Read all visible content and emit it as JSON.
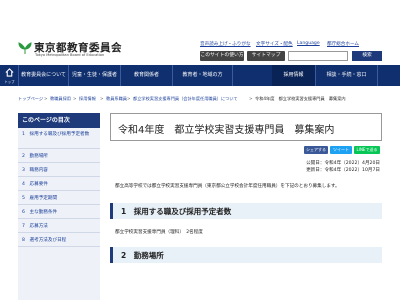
{
  "header": {
    "logo_name": "東京都教育委員会",
    "logo_sub": "Tokyo Metropolitan Board of Education",
    "util_links": [
      "音声読み上げ・ふりがな",
      "文字サイズ・配色",
      "Language",
      "都庁総合ホーム"
    ],
    "site_usage": "このサイトの使い方",
    "sitemap": "サイトマップ",
    "search_placeholder": "",
    "search_label": "検索"
  },
  "nav": {
    "home": "トップ",
    "items": [
      "教育委員会について",
      "児童・生徒・保護者",
      "教育関係者",
      "教育者・地域の方",
      "採用情報",
      "相談・手続・窓口"
    ]
  },
  "breadcrumb": [
    "トップページ",
    "教職員採用",
    "採用情報",
    "教員系職員",
    "都立学校実習支援専門員（会計年度任用職員）について",
    "令和4年度　都立学校実習支援専門員　募集案内"
  ],
  "toc": {
    "title": "このページの目次",
    "items": [
      "1　採用する職及び採用予定者数",
      "2　勤務場所",
      "3　職務内容",
      "4　応募要件",
      "5　雇用予定期間",
      "6　主な勤務条件",
      "7　応募方法",
      "8　選考方法及び日程"
    ]
  },
  "main": {
    "title": "令和4年度　都立学校実習支援専門員　募集案内",
    "share": [
      "シェアする",
      "ツイート",
      "LINEで送る"
    ],
    "published": "公開日：令和4年（2022）4月20日",
    "updated": "更新日：令和4年（2022）10月7日",
    "intro": "都立高等学校では都立学校実習支援専門員（東京都公立学校会計年度任用職員）を下記のとおり募集します。",
    "section1": "1　採用する職及び採用予定者数",
    "body1": "都立学校実習支援専門員（理科）　2名程度",
    "section2": "2　勤務場所"
  },
  "colors": {
    "navy": "#0f2f6e",
    "accent": "#1e3a7a",
    "link": "#1a3f9a",
    "facebook": "#3b5998",
    "twitter": "#1da1f2",
    "line": "#06c755"
  },
  "icons": {
    "logo": "ginkgo-logo-icon",
    "home": "house-icon"
  }
}
